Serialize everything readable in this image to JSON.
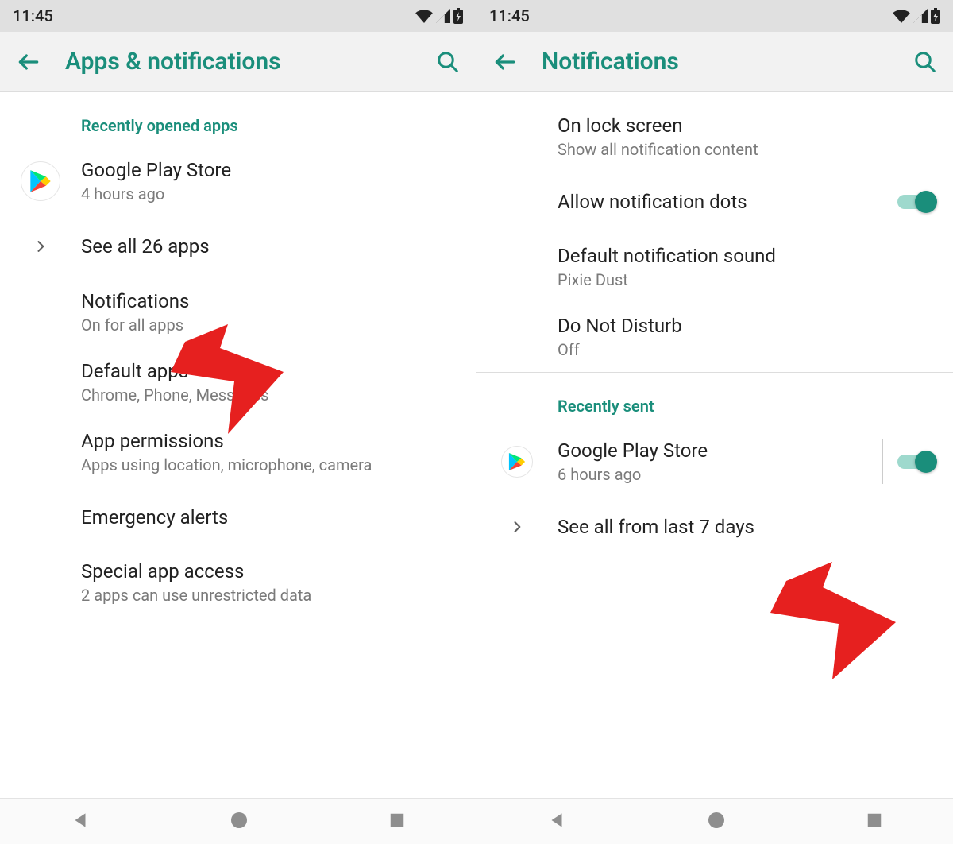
{
  "left": {
    "status": {
      "time": "11:45"
    },
    "appbar": {
      "title": "Apps & notifications"
    },
    "section_recent": "Recently opened apps",
    "recent_app": {
      "title": "Google Play Store",
      "subtitle": "4 hours ago"
    },
    "see_all": "See all 26 apps",
    "rows": {
      "notifications": {
        "title": "Notifications",
        "subtitle": "On for all apps"
      },
      "default_apps": {
        "title": "Default apps",
        "subtitle": "Chrome, Phone, Messages"
      },
      "permissions": {
        "title": "App permissions",
        "subtitle": "Apps using location, microphone, camera"
      },
      "emergency": {
        "title": "Emergency alerts"
      },
      "special": {
        "title": "Special app access",
        "subtitle": "2 apps can use unrestricted data"
      }
    }
  },
  "right": {
    "status": {
      "time": "11:45"
    },
    "appbar": {
      "title": "Notifications"
    },
    "rows": {
      "lockscreen": {
        "title": "On lock screen",
        "subtitle": "Show all notification content"
      },
      "dots": {
        "title": "Allow notification dots"
      },
      "sound": {
        "title": "Default notification sound",
        "subtitle": "Pixie Dust"
      },
      "dnd": {
        "title": "Do Not Disturb",
        "subtitle": "Off"
      }
    },
    "section_recent": "Recently sent",
    "recent_app": {
      "title": "Google Play Store",
      "subtitle": "6 hours ago"
    },
    "see_all": "See all from last 7 days"
  }
}
